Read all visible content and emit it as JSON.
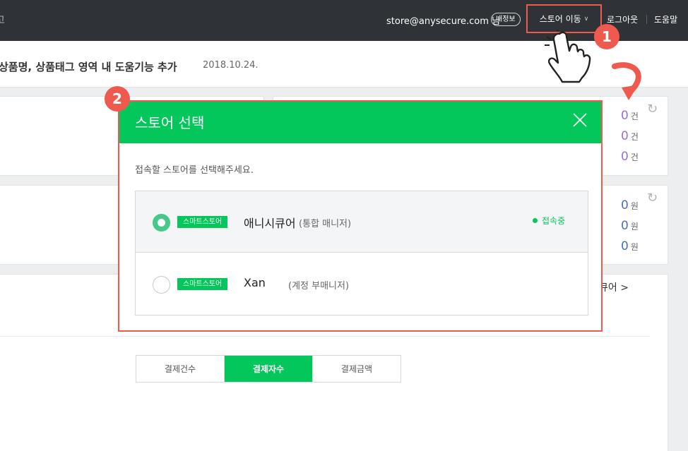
{
  "header": {
    "edge_text": "고",
    "email": "store@anysecure.com 님",
    "my_info": "내정보",
    "store_move": "스토어 이동",
    "logout": "로그아웃",
    "help": "도움말"
  },
  "notice": {
    "title": "상품명, 상품태그 영역 내 도움기능 추가",
    "date": "2018.10.24."
  },
  "stats": {
    "count_unit": "건",
    "won_unit": "원",
    "counts": [
      "0",
      "0",
      "0"
    ],
    "amounts": [
      "0",
      "0",
      "0"
    ],
    "store_link": "큐어 >"
  },
  "payment_tabs": [
    "결제건수",
    "결제자수",
    "결제금액"
  ],
  "callouts": [
    "1",
    "2"
  ],
  "modal": {
    "title": "스토어 선택",
    "description": "접속할 스토어를 선택해주세요.",
    "stores": [
      {
        "tag": "스마트스토어",
        "name": "애니시큐어",
        "role": "(통합 매니저)",
        "status": "접속중",
        "selected": true
      },
      {
        "tag": "스마트스토어",
        "name": "Xan",
        "role": "(계정 부매니저)",
        "status": "",
        "selected": false
      }
    ]
  },
  "colors": {
    "accent": "#03c75a",
    "highlight": "#ef5a4e",
    "topbar": "#2f3337"
  }
}
